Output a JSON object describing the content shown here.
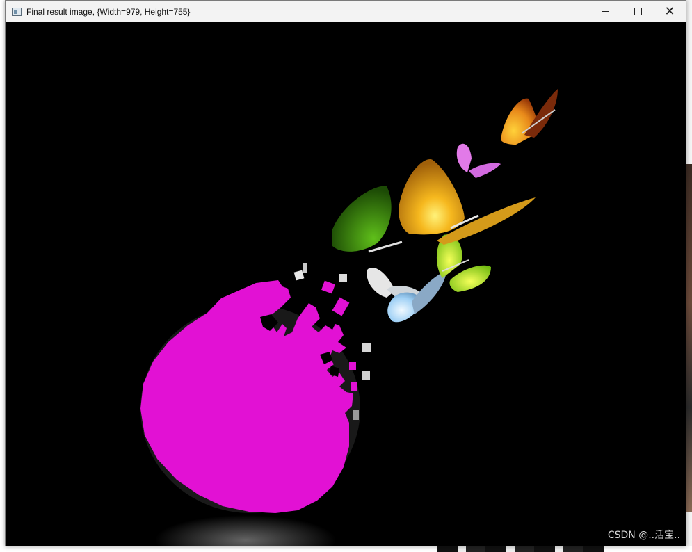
{
  "window": {
    "title": "Final result image, {Width=979, Height=755}",
    "controls": {
      "minimize": "minimize",
      "maximize": "maximize",
      "close": "close"
    }
  },
  "image": {
    "mask_color": "#E211D4",
    "background_color": "#000000",
    "watermark": "CSDN @..活宝.."
  },
  "colors": {
    "butterfly_orange": "#E8891A",
    "butterfly_gold": "#F2B21C",
    "butterfly_green": "#3B8A0E",
    "butterfly_lime": "#B8F020",
    "butterfly_pink": "#E27AE8",
    "butterfly_white": "#E6E6E6",
    "butterfly_blue": "#8FC8F2"
  }
}
